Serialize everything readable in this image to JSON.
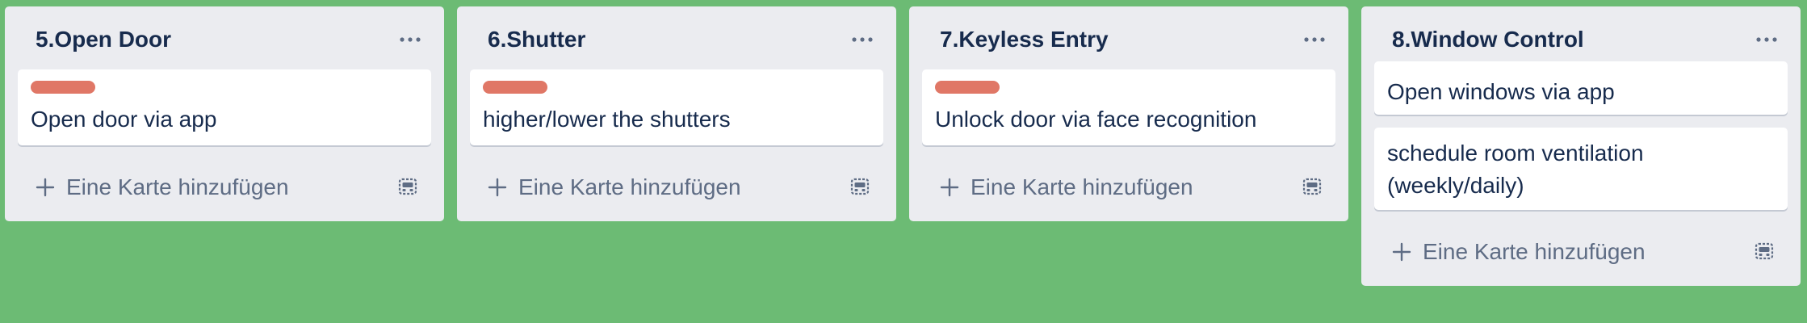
{
  "lists": [
    {
      "title": "5.Open Door",
      "cards": [
        {
          "text": "Open door via app",
          "label_color": "#e07766"
        }
      ],
      "add_card_label": "Eine Karte hinzufügen"
    },
    {
      "title": "6.Shutter",
      "cards": [
        {
          "text": "higher/lower the shutters",
          "label_color": "#e07766"
        }
      ],
      "add_card_label": "Eine Karte hinzufügen"
    },
    {
      "title": "7.Keyless Entry",
      "cards": [
        {
          "text": "Unlock door via face recognition",
          "label_color": "#e07766"
        }
      ],
      "add_card_label": "Eine Karte hinzufügen"
    },
    {
      "title": "8.Window Control",
      "cards": [
        {
          "text": "Open windows via app"
        },
        {
          "text": "schedule room ventilation (weekly/daily)"
        }
      ],
      "add_card_label": "Eine Karte hinzufügen"
    }
  ],
  "icons": {
    "list_menu": "ellipsis-icon",
    "add": "plus-icon",
    "template": "card-template-icon"
  },
  "colors": {
    "board_background": "#6cbb74",
    "list_background": "#ebecf0",
    "card_background": "#ffffff",
    "label_red": "#e07766",
    "text_primary": "#172b4d",
    "text_secondary": "#5e6c84"
  }
}
